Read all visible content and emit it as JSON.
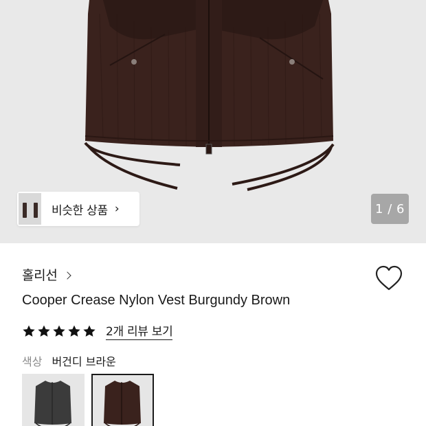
{
  "gallery": {
    "similar_button_label": "비슷한 상품",
    "similar_chevron": "›",
    "counter": "1 / 6"
  },
  "product": {
    "brand": "홀리선",
    "title": "Cooper Crease Nylon Vest Burgundy Brown",
    "rating_stars": 5,
    "review_link": "2개 리뷰 보기",
    "color_label": "색상",
    "color_value": "버건디 브라운",
    "swatches": [
      {
        "name": "charcoal",
        "color": "#3b3b3b"
      },
      {
        "name": "burgundy-brown",
        "color": "#3a221d",
        "selected": true
      }
    ]
  },
  "icons": {
    "wishlist": "heart-outline-icon",
    "star": "star-filled-icon"
  },
  "colors": {
    "vest_body": "#3a221d",
    "hero_bg": "#e9e9e9",
    "counter_bg": "#a7a7a7"
  }
}
